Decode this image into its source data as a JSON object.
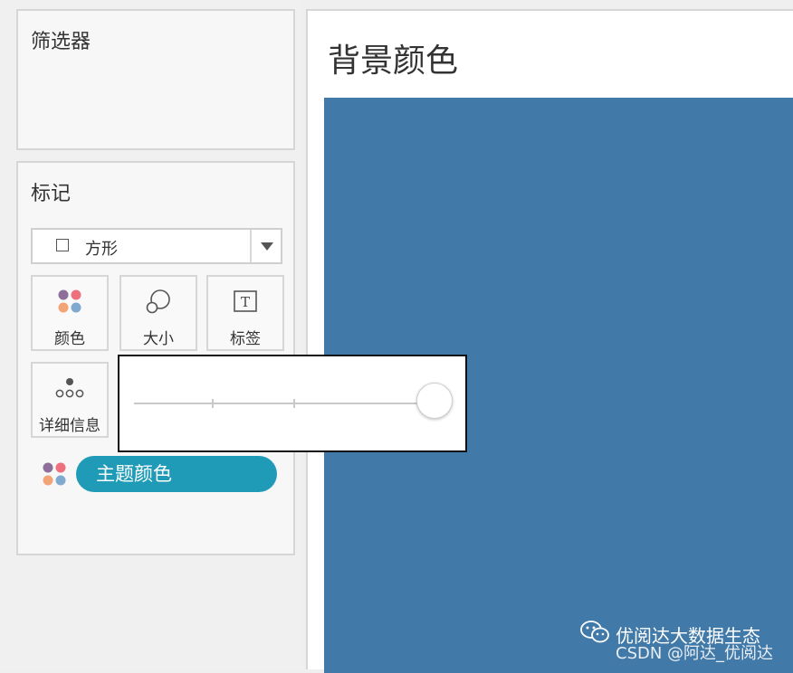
{
  "filters": {
    "title": "筛选器"
  },
  "marks": {
    "title": "标记",
    "mark_type": {
      "icon": "square-icon",
      "label": "方形"
    },
    "buttons": [
      {
        "name": "color",
        "label": "颜色",
        "icon": "color-dots-icon"
      },
      {
        "name": "size",
        "label": "大小",
        "icon": "size-circles-icon"
      },
      {
        "name": "label",
        "label": "标签",
        "icon": "text-label-icon"
      },
      {
        "name": "detail",
        "label": "详细信息",
        "icon": "detail-dots-icon"
      }
    ],
    "pill": {
      "label": "主题颜色",
      "color": "#1f9bb8"
    }
  },
  "size_slider": {
    "value": 1.0,
    "ticks": 3
  },
  "sheet": {
    "title": "背景颜色",
    "fill_color": "#417aa9"
  },
  "watermark": {
    "main": "优阅达大数据生态",
    "sub": "CSDN @阿达_优阅达",
    "icon": "wechat-icon"
  },
  "colors": {
    "dot_purple": "#8e6f9a",
    "dot_pink": "#ee6f7e",
    "dot_orange": "#f2a477",
    "dot_blue": "#7fa9cf"
  }
}
